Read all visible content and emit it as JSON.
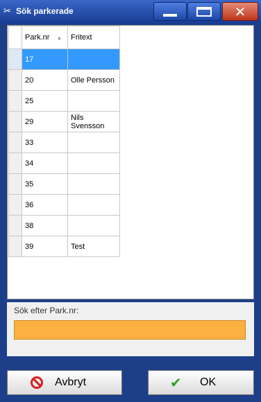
{
  "window": {
    "title": "Sök parkerade",
    "app_icon": "scissors-icon"
  },
  "grid": {
    "columns": [
      "Park.nr",
      "Fritext"
    ],
    "sort_column": "Park.nr",
    "selected_row": 0,
    "rows": [
      {
        "park_nr": "17",
        "fritext": ""
      },
      {
        "park_nr": "20",
        "fritext": "Olle Persson"
      },
      {
        "park_nr": "25",
        "fritext": ""
      },
      {
        "park_nr": "29",
        "fritext": "Nils Svensson"
      },
      {
        "park_nr": "33",
        "fritext": ""
      },
      {
        "park_nr": "34",
        "fritext": ""
      },
      {
        "park_nr": "35",
        "fritext": ""
      },
      {
        "park_nr": "36",
        "fritext": ""
      },
      {
        "park_nr": "38",
        "fritext": ""
      },
      {
        "park_nr": "39",
        "fritext": "Test"
      }
    ]
  },
  "search": {
    "label": "Sök efter Park.nr:",
    "value": ""
  },
  "buttons": {
    "cancel": "Avbryt",
    "ok": "OK"
  },
  "colors": {
    "selection": "#3399ff",
    "input_bg": "#fbb040",
    "titlebar": "#1d3f8a"
  }
}
